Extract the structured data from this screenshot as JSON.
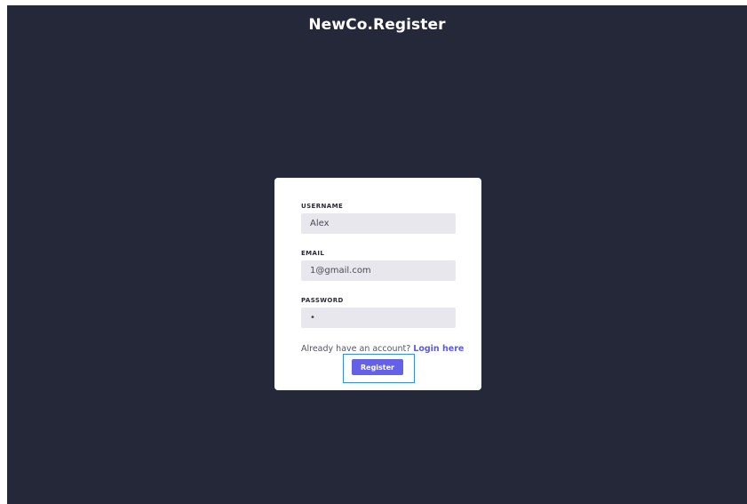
{
  "app": {
    "title": "NewCo.Register"
  },
  "form": {
    "username": {
      "label": "USERNAME",
      "value": "Alex"
    },
    "email": {
      "label": "EMAIL",
      "value": "1@gmail.com"
    },
    "password": {
      "label": "PASSWORD",
      "value": "•"
    },
    "login_prompt": "Already have an account?",
    "login_link": "Login here",
    "submit_label": "Register"
  },
  "colors": {
    "background": "#252839",
    "card": "#ffffff",
    "input_bg": "#e8e7ee",
    "accent": "#6461e8",
    "link": "#5b5be6",
    "focus_outline": "#2f8fe6"
  }
}
